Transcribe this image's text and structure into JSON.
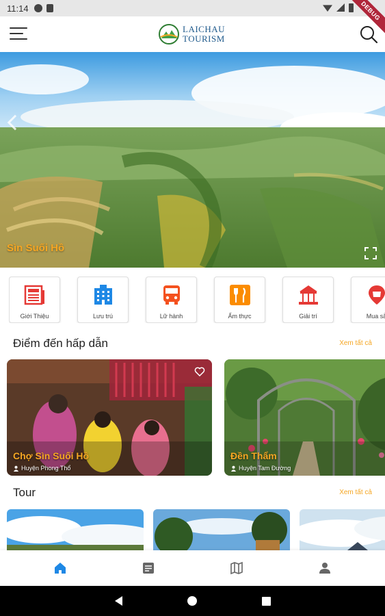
{
  "status_bar": {
    "time": "11:14"
  },
  "debug_banner": "DEBUG",
  "app_bar": {
    "logo_line1": "LAICHAU",
    "logo_line2": "TOURISM"
  },
  "hero": {
    "caption": "Sìn Suối Hồ"
  },
  "categories": [
    {
      "label": "Giới Thiệu",
      "icon": "newspaper-icon",
      "color": "#e53935"
    },
    {
      "label": "Lưu trú",
      "icon": "hotel-icon",
      "color": "#1e88e5"
    },
    {
      "label": "Lữ hành",
      "icon": "bus-icon",
      "color": "#f4511e"
    },
    {
      "label": "Ẩm thực",
      "icon": "restaurant-icon",
      "color": "#fb8c00"
    },
    {
      "label": "Giải trí",
      "icon": "carousel-icon",
      "color": "#e53935"
    },
    {
      "label": "Mua sắ",
      "icon": "shopping-icon",
      "color": "#e53935"
    }
  ],
  "destinations": {
    "title": "Điểm đến hấp dẫn",
    "see_all": "Xem tất cả",
    "items": [
      {
        "name": "Chợ Sìn Suối Hồ",
        "location": "Huyện Phong Thổ"
      },
      {
        "name": "Đền Thẩm",
        "location": "Huyện Tam Đường"
      }
    ]
  },
  "tours": {
    "title": "Tour",
    "see_all": "Xem tất cả"
  },
  "bottom_nav": [
    "home-icon",
    "news-icon",
    "map-icon",
    "profile-icon"
  ],
  "accent_color": "#f5a623",
  "active_nav_color": "#1e88e5"
}
